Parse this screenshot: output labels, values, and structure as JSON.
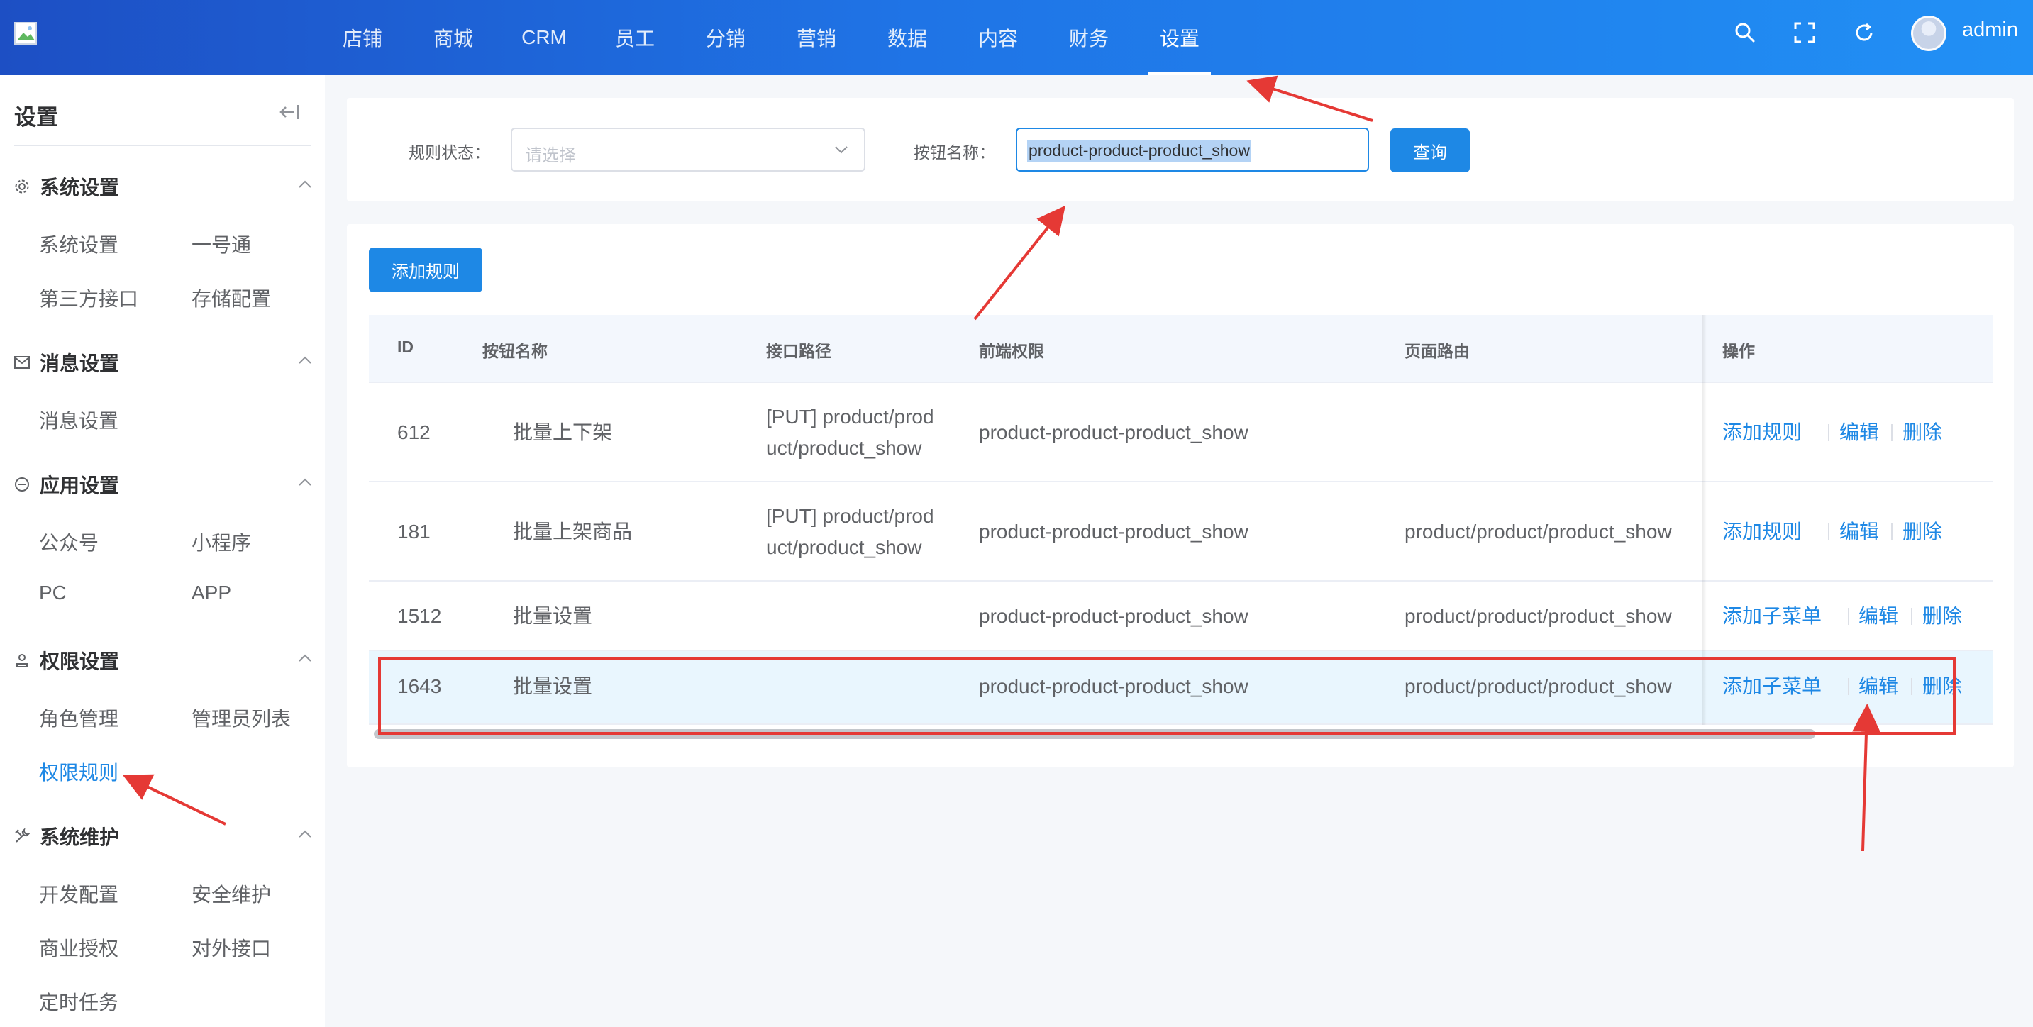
{
  "header": {
    "nav": [
      "店铺",
      "商城",
      "CRM",
      "员工",
      "分销",
      "营销",
      "数据",
      "内容",
      "财务",
      "设置"
    ],
    "active_nav": "设置",
    "user": "admin"
  },
  "sidebar": {
    "title": "设置",
    "groups": [
      {
        "label": "系统设置",
        "icon": "gear-icon",
        "items": [
          "系统设置",
          "一号通",
          "第三方接口",
          "存储配置"
        ]
      },
      {
        "label": "消息设置",
        "icon": "envelope-icon",
        "items": [
          "消息设置"
        ]
      },
      {
        "label": "应用设置",
        "icon": "app-icon",
        "items": [
          "公众号",
          "小程序",
          "PC",
          "APP"
        ]
      },
      {
        "label": "权限设置",
        "icon": "user-icon",
        "items": [
          "角色管理",
          "管理员列表",
          "权限规则"
        ]
      },
      {
        "label": "系统维护",
        "icon": "tools-icon",
        "items": [
          "开发配置",
          "安全维护",
          "商业授权",
          "对外接口",
          "定时任务"
        ]
      }
    ],
    "active_item": "权限规则"
  },
  "filter": {
    "status_label": "规则状态：",
    "status_placeholder": "请选择",
    "name_label": "按钮名称：",
    "name_value": "product-product-product_show",
    "query_button": "查询"
  },
  "toolbar": {
    "add_rule": "添加规则"
  },
  "table": {
    "columns": [
      "ID",
      "按钮名称",
      "接口路径",
      "前端权限",
      "页面路由",
      "操作"
    ],
    "rows": [
      {
        "id": "612",
        "name": "批量上下架",
        "api_line1": "[PUT] product/prod",
        "api_line2": "uct/product_show",
        "perm": "product-product-product_show",
        "route": "",
        "op_add": "添加规则",
        "op_edit": "编辑",
        "op_delete": "删除"
      },
      {
        "id": "181",
        "name": "批量上架商品",
        "api_line1": "[PUT] product/prod",
        "api_line2": "uct/product_show",
        "perm": "product-product-product_show",
        "route": "product/product/product_show",
        "op_add": "添加规则",
        "op_edit": "编辑",
        "op_delete": "删除"
      },
      {
        "id": "1512",
        "name": "批量设置",
        "api_line1": "",
        "api_line2": "",
        "perm": "product-product-product_show",
        "route": "product/product/product_show",
        "op_add": "添加子菜单",
        "op_edit": "编辑",
        "op_delete": "删除"
      },
      {
        "id": "1643",
        "name": "批量设置",
        "api_line1": "",
        "api_line2": "",
        "perm": "product-product-product_show",
        "route": "product/product/product_show",
        "op_add": "添加子菜单",
        "op_edit": "编辑",
        "op_delete": "删除"
      }
    ]
  },
  "colors": {
    "primary": "#1e88e5",
    "annotation": "#e53935",
    "header_start": "#1d4fc4",
    "header_end": "#2190f5"
  }
}
